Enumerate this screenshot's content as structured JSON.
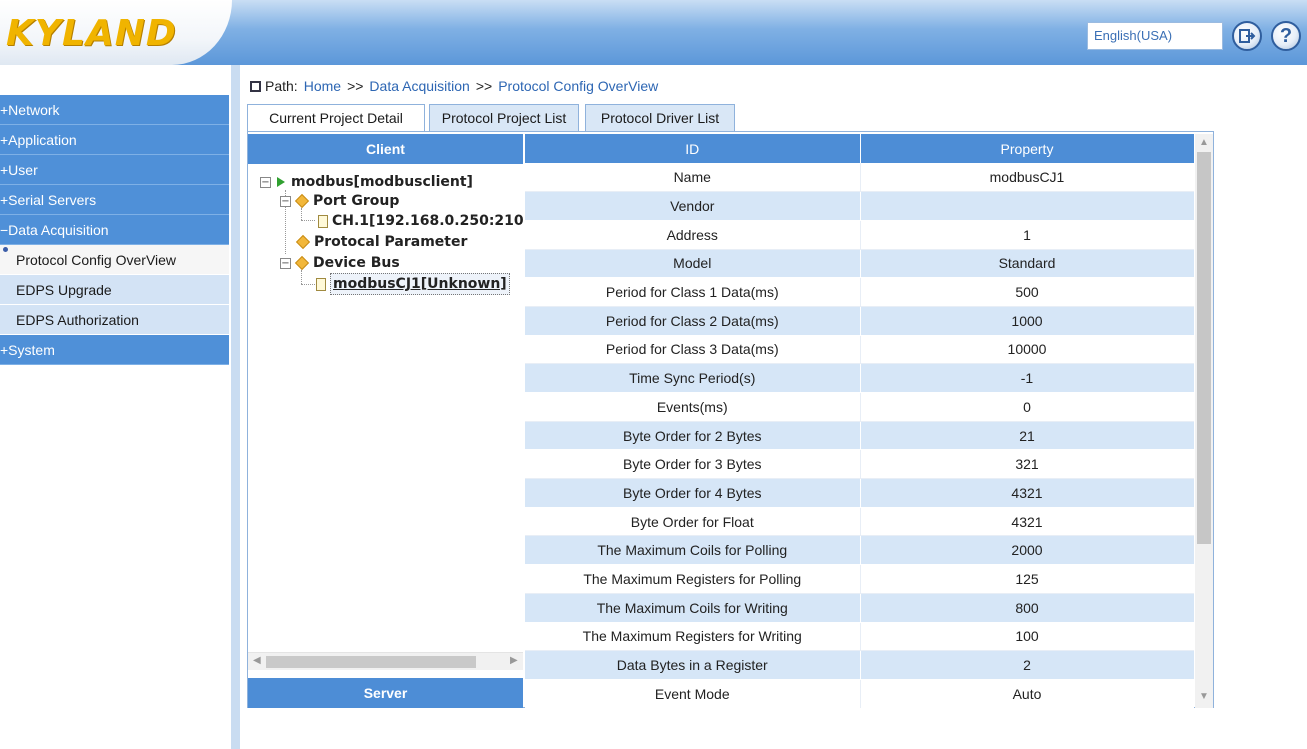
{
  "header": {
    "logo_text": "KYLAND",
    "language": "English(USA)",
    "logout_icon": "logout-icon",
    "help_icon": "help-icon",
    "help_glyph": "?"
  },
  "sidebar": {
    "items": [
      {
        "label": "+Network",
        "kind": "group"
      },
      {
        "label": "+Application",
        "kind": "group"
      },
      {
        "label": "+User",
        "kind": "group"
      },
      {
        "label": "+Serial Servers",
        "kind": "group"
      },
      {
        "label": "−Data Acquisition",
        "kind": "group"
      },
      {
        "label": "Protocol Config OverView",
        "kind": "sub",
        "active": true
      },
      {
        "label": "EDPS Upgrade",
        "kind": "sub"
      },
      {
        "label": "EDPS Authorization",
        "kind": "sub"
      },
      {
        "label": "+System",
        "kind": "group"
      }
    ]
  },
  "breadcrumb": {
    "label": "Path:",
    "home": "Home",
    "section": "Data Acquisition",
    "page": "Protocol Config OverView",
    "separator": ">>"
  },
  "tabs": [
    {
      "label": "Current Project Detail",
      "active": true
    },
    {
      "label": "Protocol Project List",
      "active": false
    },
    {
      "label": "Protocol Driver List",
      "active": false
    }
  ],
  "tree": {
    "client_header": "Client",
    "server_header": "Server",
    "root": "modbus[modbusclient]",
    "port_group": "Port Group",
    "channel": "CH.1[192.168.0.250:210",
    "protocal_parameter": "Protocal Parameter",
    "device_bus": "Device Bus",
    "device": "modbusCJ1[Unknown]"
  },
  "properties": {
    "columns": [
      "ID",
      "Property"
    ],
    "rows": [
      [
        "Name",
        "modbusCJ1"
      ],
      [
        "Vendor",
        ""
      ],
      [
        "Address",
        "1"
      ],
      [
        "Model",
        "Standard"
      ],
      [
        "Period for Class 1 Data(ms)",
        "500"
      ],
      [
        "Period for Class 2 Data(ms)",
        "1000"
      ],
      [
        "Period for Class 3 Data(ms)",
        "10000"
      ],
      [
        "Time Sync Period(s)",
        "-1"
      ],
      [
        "Events(ms)",
        "0"
      ],
      [
        "Byte Order for 2 Bytes",
        "21"
      ],
      [
        "Byte Order for 3 Bytes",
        "321"
      ],
      [
        "Byte Order for 4 Bytes",
        "4321"
      ],
      [
        "Byte Order for Float",
        "4321"
      ],
      [
        "The Maximum Coils for Polling",
        "2000"
      ],
      [
        "The Maximum Registers for Polling",
        "125"
      ],
      [
        "The Maximum Coils for Writing",
        "800"
      ],
      [
        "The Maximum Registers for Writing",
        "100"
      ],
      [
        "Data Bytes in a Register",
        "2"
      ],
      [
        "Event Mode",
        "Auto"
      ]
    ]
  },
  "colors": {
    "accent": "#4d8dd6",
    "row_alt": "#d6e6f7",
    "link": "#2d66b3",
    "logo": "#f0b400"
  }
}
